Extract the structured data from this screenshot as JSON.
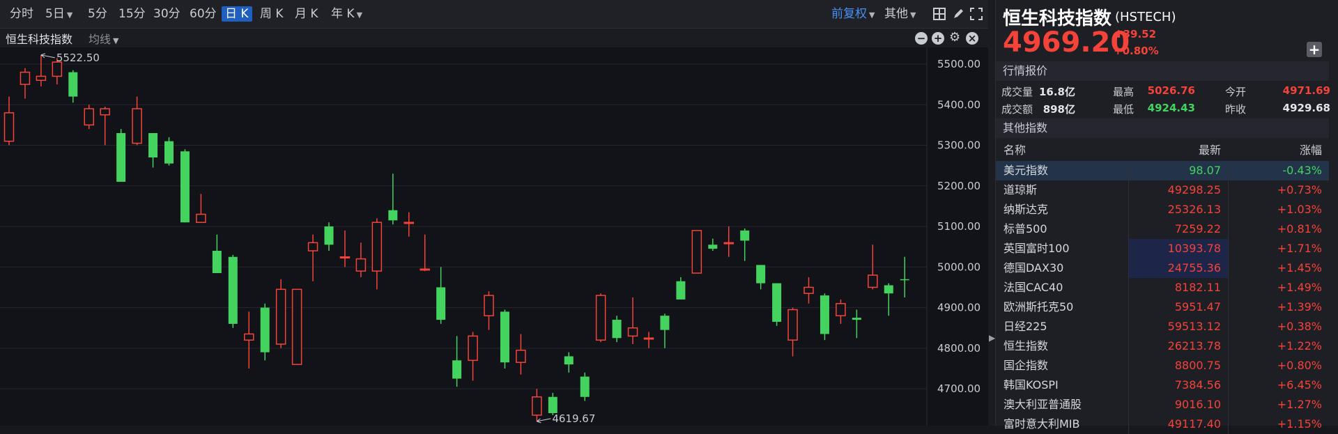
{
  "toolbar": {
    "periods": [
      "分时",
      "5日",
      "5分",
      "15分",
      "30分",
      "60分",
      "日 K",
      "周 K",
      "月 K",
      "年 K"
    ],
    "active_period": "日 K",
    "adjust_label": "前复权",
    "other_label": "其他"
  },
  "subbar": {
    "index_name": "恒生科技指数",
    "ma_label": "均线"
  },
  "chart": {
    "y_ticks": [
      "5500.00",
      "5400.00",
      "5300.00",
      "5200.00",
      "5100.00",
      "5000.00",
      "4900.00",
      "4800.00",
      "4700.00"
    ],
    "high_label": "5522.50",
    "low_label": "4619.67",
    "up_color": "#f5433a",
    "down_color": "#45d35f"
  },
  "chart_data": {
    "type": "candlestick",
    "y_range": [
      4600,
      5560
    ],
    "candles": [
      {
        "o": 5310,
        "c": 5380,
        "h": 5420,
        "l": 5300
      },
      {
        "o": 5450,
        "c": 5480,
        "h": 5490,
        "l": 5415
      },
      {
        "o": 5460,
        "c": 5470,
        "h": 5522.5,
        "l": 5445
      },
      {
        "o": 5470,
        "c": 5505,
        "h": 5515,
        "l": 5450
      },
      {
        "o": 5480,
        "c": 5420,
        "h": 5485,
        "l": 5405
      },
      {
        "o": 5350,
        "c": 5390,
        "h": 5400,
        "l": 5340
      },
      {
        "o": 5375,
        "c": 5390,
        "h": 5395,
        "l": 5300
      },
      {
        "o": 5330,
        "c": 5210,
        "h": 5340,
        "l": 5210
      },
      {
        "o": 5305,
        "c": 5390,
        "h": 5420,
        "l": 5300
      },
      {
        "o": 5330,
        "c": 5270,
        "h": 5330,
        "l": 5245
      },
      {
        "o": 5310,
        "c": 5255,
        "h": 5320,
        "l": 5250
      },
      {
        "o": 5285,
        "c": 5110,
        "h": 5290,
        "l": 5110
      },
      {
        "o": 5110,
        "c": 5130,
        "h": 5180,
        "l": 5110
      },
      {
        "o": 5040,
        "c": 4985,
        "h": 5080,
        "l": 4985
      },
      {
        "o": 5025,
        "c": 4860,
        "h": 5030,
        "l": 4850
      },
      {
        "o": 4820,
        "c": 4835,
        "h": 4890,
        "l": 4750
      },
      {
        "o": 4900,
        "c": 4790,
        "h": 4910,
        "l": 4770
      },
      {
        "o": 4810,
        "c": 4945,
        "h": 4970,
        "l": 4800
      },
      {
        "o": 4760,
        "c": 4945,
        "h": 4945,
        "l": 4760
      },
      {
        "o": 5040,
        "c": 5060,
        "h": 5080,
        "l": 4965
      },
      {
        "o": 5100,
        "c": 5055,
        "h": 5110,
        "l": 5040
      },
      {
        "o": 5025,
        "c": 5025,
        "h": 5090,
        "l": 5000
      },
      {
        "o": 4990,
        "c": 5020,
        "h": 5060,
        "l": 4975
      },
      {
        "o": 4990,
        "c": 5110,
        "h": 5120,
        "l": 4945
      },
      {
        "o": 5140,
        "c": 5115,
        "h": 5230,
        "l": 5105
      },
      {
        "o": 5110,
        "c": 5110,
        "h": 5135,
        "l": 5075
      },
      {
        "o": 4995,
        "c": 4995,
        "h": 5080,
        "l": 4990
      },
      {
        "o": 4950,
        "c": 4870,
        "h": 5000,
        "l": 4860
      },
      {
        "o": 4770,
        "c": 4725,
        "h": 4830,
        "l": 4705
      },
      {
        "o": 4770,
        "c": 4830,
        "h": 4840,
        "l": 4720
      },
      {
        "o": 4880,
        "c": 4930,
        "h": 4940,
        "l": 4845
      },
      {
        "o": 4890,
        "c": 4765,
        "h": 4895,
        "l": 4750
      },
      {
        "o": 4765,
        "c": 4795,
        "h": 4835,
        "l": 4735
      },
      {
        "o": 4635,
        "c": 4680,
        "h": 4700,
        "l": 4619.67
      },
      {
        "o": 4680,
        "c": 4640,
        "h": 4690,
        "l": 4635
      },
      {
        "o": 4780,
        "c": 4760,
        "h": 4790,
        "l": 4740
      },
      {
        "o": 4730,
        "c": 4680,
        "h": 4740,
        "l": 4670
      },
      {
        "o": 4820,
        "c": 4930,
        "h": 4935,
        "l": 4815
      },
      {
        "o": 4870,
        "c": 4825,
        "h": 4880,
        "l": 4815
      },
      {
        "o": 4830,
        "c": 4850,
        "h": 4925,
        "l": 4810
      },
      {
        "o": 4825,
        "c": 4825,
        "h": 4840,
        "l": 4800
      },
      {
        "o": 4880,
        "c": 4845,
        "h": 4885,
        "l": 4800
      },
      {
        "o": 4965,
        "c": 4920,
        "h": 4975,
        "l": 4920
      },
      {
        "o": 4985,
        "c": 5090,
        "h": 5090,
        "l": 4985
      },
      {
        "o": 5055,
        "c": 5045,
        "h": 5070,
        "l": 5040
      },
      {
        "o": 5060,
        "c": 5060,
        "h": 5100,
        "l": 5025
      },
      {
        "o": 5090,
        "c": 5065,
        "h": 5095,
        "l": 5015
      },
      {
        "o": 5005,
        "c": 4960,
        "h": 5005,
        "l": 4945
      },
      {
        "o": 4960,
        "c": 4865,
        "h": 4960,
        "l": 4855
      },
      {
        "o": 4820,
        "c": 4895,
        "h": 4900,
        "l": 4780
      },
      {
        "o": 4935,
        "c": 4950,
        "h": 4975,
        "l": 4910
      },
      {
        "o": 4930,
        "c": 4835,
        "h": 4935,
        "l": 4820
      },
      {
        "o": 4880,
        "c": 4910,
        "h": 4920,
        "l": 4860
      },
      {
        "o": 4875,
        "c": 4870,
        "h": 4895,
        "l": 4825
      },
      {
        "o": 4950,
        "c": 4980,
        "h": 5055,
        "l": 4945
      },
      {
        "o": 4955,
        "c": 4935,
        "h": 4960,
        "l": 4880
      },
      {
        "o": 4970,
        "c": 4969.2,
        "h": 5025,
        "l": 4925
      }
    ]
  },
  "header": {
    "name": "恒生科技指数",
    "code": "(HSTECH)",
    "price": "4969.20",
    "change": "39.52",
    "change_pct": "+0.80%",
    "add_icon": "plus-icon"
  },
  "quote": {
    "title": "行情报价",
    "volume_label": "成交量",
    "volume": "16.8亿",
    "high_label": "最高",
    "high": "5026.76",
    "open_label": "今开",
    "open": "4971.69",
    "amount_label": "成交额",
    "amount": "898亿",
    "low_label": "最低",
    "low": "4924.43",
    "prev_close_label": "昨收",
    "prev_close": "4929.68"
  },
  "others": {
    "title": "其他指数",
    "headers": {
      "name": "名称",
      "latest": "最新",
      "change": "涨幅"
    },
    "rows": [
      {
        "name": "美元指数",
        "latest": "98.07",
        "change": "-0.43%"
      },
      {
        "name": "道琼斯",
        "latest": "49298.25",
        "change": "+0.73%"
      },
      {
        "name": "纳斯达克",
        "latest": "25326.13",
        "change": "+1.03%"
      },
      {
        "name": "标普500",
        "latest": "7259.22",
        "change": "+0.81%"
      },
      {
        "name": "英国富时100",
        "latest": "10393.78",
        "change": "+1.71%"
      },
      {
        "name": "德国DAX30",
        "latest": "24755.36",
        "change": "+1.45%"
      },
      {
        "name": "法国CAC40",
        "latest": "8182.11",
        "change": "+1.49%"
      },
      {
        "name": "欧洲斯托克50",
        "latest": "5951.47",
        "change": "+1.39%"
      },
      {
        "name": "日经225",
        "latest": "59513.12",
        "change": "+0.38%"
      },
      {
        "name": "恒生指数",
        "latest": "26213.78",
        "change": "+1.22%"
      },
      {
        "name": "国企指数",
        "latest": "8800.75",
        "change": "+0.80%"
      },
      {
        "name": "韩国KOSPI",
        "latest": "7384.56",
        "change": "+6.45%"
      },
      {
        "name": "澳大利亚普通股",
        "latest": "9016.10",
        "change": "+1.27%"
      },
      {
        "name": "富时意大利MIB",
        "latest": "49117.40",
        "change": "+1.15%"
      }
    ]
  }
}
